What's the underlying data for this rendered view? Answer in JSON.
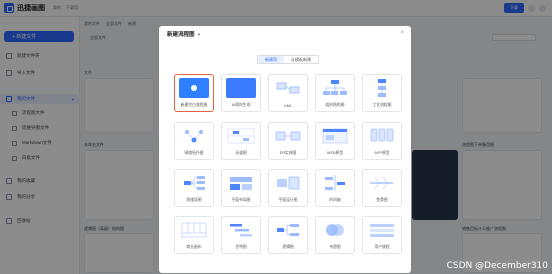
{
  "app": {
    "title": "迅捷画图",
    "top_links": [
      "我的",
      "下载用"
    ],
    "download_label": "下载",
    "breadcrumbs": [
      "我的文件",
      "全部文件",
      "新建"
    ]
  },
  "sidebar": {
    "new_file_label": "+ 新建文件",
    "items": [
      {
        "label": "新建文件夹"
      },
      {
        "label": "导入文件"
      },
      {
        "label": "我的文件"
      },
      {
        "label": "流程图文件"
      },
      {
        "label": "思维导图文件"
      },
      {
        "label": "Markdown文件"
      },
      {
        "label": "白板文件"
      },
      {
        "label": "我的收藏"
      },
      {
        "label": "我的分享"
      },
      {
        "label": "回收站"
      }
    ]
  },
  "main": {
    "filter_label": "全部文件",
    "section_label": "文件",
    "card_titles": [
      "未命名文件",
      "逻辑图（高级）结构图",
      "流程图下单备用图",
      "销售目标什么推广流程图"
    ]
  },
  "dialog": {
    "title": "新建流程图",
    "close": "×",
    "tabs": [
      "新建项",
      "从模板新建"
    ],
    "tiles": [
      {
        "label": "新建空白流程图"
      },
      {
        "label": "AI帮你生成"
      },
      {
        "label": "UML"
      },
      {
        "label": "组织结构图"
      },
      {
        "label": "工艺流程图"
      },
      {
        "label": "网络拓扑图"
      },
      {
        "label": "泳道图"
      },
      {
        "label": "ER实体图"
      },
      {
        "label": "WEB原型"
      },
      {
        "label": "APP原型"
      },
      {
        "label": "思维导图"
      },
      {
        "label": "平面布局图"
      },
      {
        "label": "平面设计图"
      },
      {
        "label": "时间轴"
      },
      {
        "label": "鱼骨图"
      },
      {
        "label": "商业画布"
      },
      {
        "label": "甘特图"
      },
      {
        "label": "逻辑图"
      },
      {
        "label": "韦恩图"
      },
      {
        "label": "用户旅程"
      }
    ]
  },
  "watermark": "CSDN @December310",
  "colors": {
    "accent": "#2f6bff",
    "selected_border": "#e0643a"
  }
}
